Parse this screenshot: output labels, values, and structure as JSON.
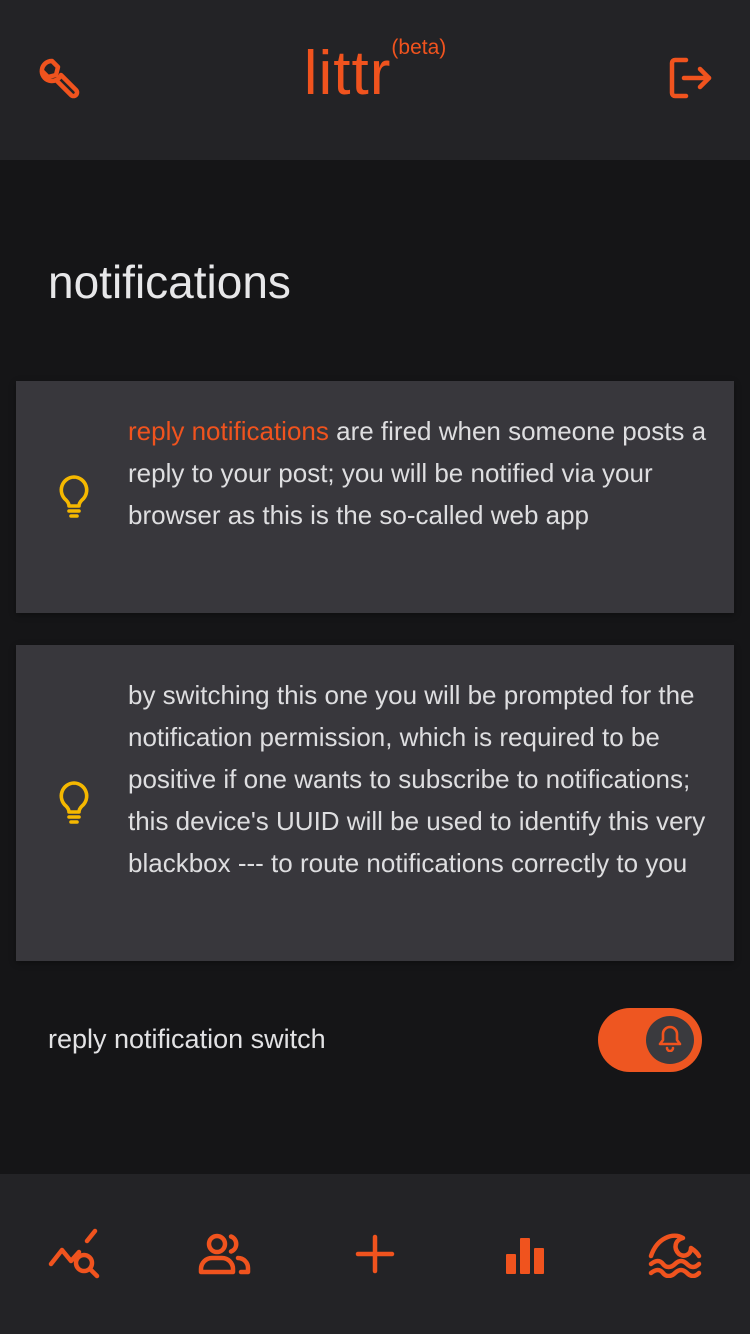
{
  "app": {
    "name": "littr",
    "badge": "(beta)"
  },
  "header": {
    "left_icon": "wrench-icon",
    "right_icon": "logout-icon"
  },
  "page": {
    "title": "notifications"
  },
  "cards": [
    {
      "icon": "lightbulb-icon",
      "highlight": "reply notifications",
      "text": " are fired when someone posts a reply to your post; you will be notified via your browser as this is the so-called web app"
    },
    {
      "icon": "lightbulb-icon",
      "text": "by switching this one you will be prompted for the notification permission, which is required to be positive if one wants to subscribe to notifications; this device's UUID will be used to identify this very blackbox --- to route notifications correctly to you"
    }
  ],
  "switch": {
    "label": "reply notification switch",
    "state": "on",
    "knob_icon": "bell-icon"
  },
  "bottom_nav": [
    {
      "icon": "chart-search-icon"
    },
    {
      "icon": "users-icon"
    },
    {
      "icon": "plus-icon"
    },
    {
      "icon": "bar-chart-icon"
    },
    {
      "icon": "waves-icon"
    }
  ],
  "colors": {
    "accent": "#f0531e",
    "bulb": "#f5b800",
    "background": "#151517",
    "bar": "#232326",
    "card": "#38373c"
  }
}
